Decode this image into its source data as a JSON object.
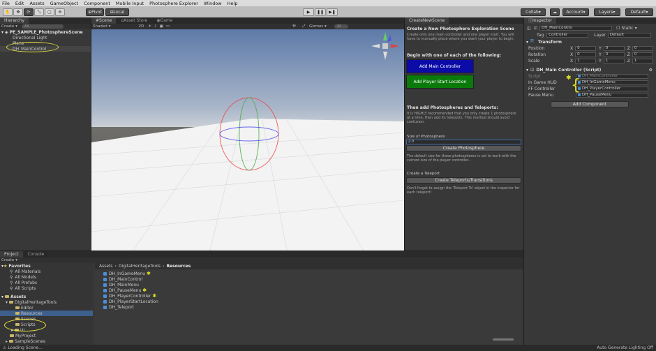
{
  "menu": [
    "File",
    "Edit",
    "Assets",
    "GameObject",
    "Component",
    "Mobile Input",
    "Photosphere Explorer",
    "Window",
    "Help"
  ],
  "toolbar": {
    "pivot": "Pivot",
    "local": "Local",
    "collab": "Collab",
    "account": "Account",
    "layers": "Layers",
    "layout": "Default"
  },
  "hierarchy": {
    "tab": "Hierarchy",
    "create": "Create",
    "search": "All",
    "scene": "PE_SAMPLE_PhotosphereScene",
    "items": [
      "Directional Light",
      "Plane",
      "DH_MainControl"
    ]
  },
  "scene": {
    "tabs": [
      "Scene",
      "Asset Store",
      "Game"
    ],
    "shading": "Shaded",
    "mode2d": "2D",
    "gizmos": "Gizmos",
    "search": "All"
  },
  "createScene": {
    "tab": "CreateNewScene",
    "title": "Create a New Photosphere Exploration Scene",
    "desc": "Create only one main controller and one player start. You will have to manually place where you want your player to begin.",
    "begin": "Begin with one of each of the following:",
    "addMain": "Add Main Controller",
    "addStart": "Add Player Start Location",
    "then": "Then add Photospheres and Teleports:",
    "thenDesc": "It is HIGHLY recommended that you only create 1 photosphere at a time, then add its teleports. This method should avoid confusion.",
    "sizeLabel": "Size of Photosphere",
    "sizeValue": "2.0",
    "createPhotosphere": "Create Photosphere",
    "sizeDesc": "The default size for these photospheres is set to work with the current size of the player controller...",
    "teleportLabel": "Create a Teleport",
    "createTeleports": "Create Teleports/Transitions",
    "teleportDesc": "Don't forget to assign the 'Teleport To' object in the inspector for each teleport!"
  },
  "inspector": {
    "tab": "Inspector",
    "objectName": "DH_MainControl",
    "static": "Static",
    "tagLabel": "Tag",
    "tag": "Controller",
    "layerLabel": "Layer",
    "layer": "Default",
    "transform": "Transform",
    "position": "Position",
    "rotation": "Rotation",
    "scale": "Scale",
    "pos": [
      "0",
      "0",
      "0"
    ],
    "rot": [
      "0",
      "0",
      "0"
    ],
    "scl": [
      "1",
      "1",
      "1"
    ],
    "axes": [
      "X",
      "Y",
      "Z"
    ],
    "component": "DH_Main Controller (Script)",
    "scriptLabel": "Script",
    "script": "DH_MainController",
    "fields": [
      {
        "label": "In Game HUD",
        "value": "DH_InGameMenu"
      },
      {
        "label": "FF Controller",
        "value": "DH_PlayerController"
      },
      {
        "label": "Pause Menu",
        "value": "DH_PauseMenu"
      }
    ],
    "addComponent": "Add Component"
  },
  "project": {
    "tabs": [
      "Project",
      "Console"
    ],
    "create": "Create",
    "favorites": "Favorites",
    "favItems": [
      "All Materials",
      "All Models",
      "All Prefabs",
      "All Scripts"
    ],
    "assets": "Assets",
    "tree": [
      "DigitalHeritageTools",
      "Editor",
      "Resources",
      "Scenes",
      "Scripts",
      "UI",
      "MyProject",
      "SampleScenes"
    ],
    "breadcrumb": [
      "Assets",
      "DigitalHeritageTools",
      "Resources"
    ],
    "files": [
      "DH_InGameMenu",
      "DH_MainControl",
      "DH_MainMenu",
      "DH_PauseMenu",
      "DH_PlayerController",
      "DH_PlayerStartLocation",
      "DH_Teleport"
    ]
  },
  "status": {
    "left": "Loading Scene...",
    "right": "Auto Generate Lighting Off"
  },
  "colors": {
    "highlight": "#e6e040",
    "selection": "#3d5f8c",
    "buttonBlue": "#0b0ba8",
    "buttonGreen": "#0a7a0a"
  }
}
